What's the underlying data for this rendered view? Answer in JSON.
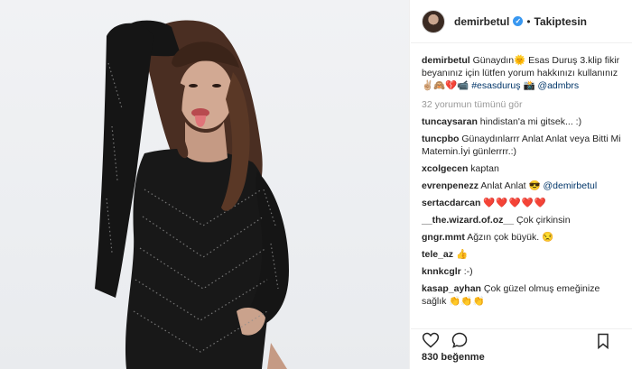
{
  "header": {
    "username": "demirbetul",
    "separator": "•",
    "follow_status": "Takiptesin"
  },
  "caption": {
    "username": "demirbetul",
    "text_1": "Günaydın🌞 Esas Duruş 3.klip fikir beyanınız için lütfen yorum hakkınızı kullanınız✌🏼🙈💔📹",
    "hashtag": "#esasduruş",
    "emoji": "📸",
    "mention": "@admbrs"
  },
  "view_all": "32 yorumun tümünü gör",
  "comments": [
    {
      "user": "tuncaysaran",
      "text": "hindistan'a mi gitsek... :)"
    },
    {
      "user": "tuncpbo",
      "text": "Günaydınlarrr Anlat Anlat veya Bitti Mi Matemin.İyi günlerrrr.:)"
    },
    {
      "user": "xcolgecen",
      "text": "kaptan"
    },
    {
      "user": "evrenpenezz",
      "text": "Anlat Anlat 😎",
      "mention": "@demirbetul"
    },
    {
      "user": "sertacdarcan",
      "text": "❤️❤️❤️❤️❤️"
    },
    {
      "user": "__the.wizard.of.oz__",
      "text": "Çok çirkinsin"
    },
    {
      "user": "gngr.mmt",
      "text": "Ağzın çok büyük. 😒"
    },
    {
      "user": "tele_az",
      "text": "👍"
    },
    {
      "user": "knnkcglr",
      "text": ":-)"
    },
    {
      "user": "kasap_ayhan",
      "text": "Çok güzel olmuş emeğinize sağlık 👏👏👏"
    }
  ],
  "likes": "830 beğenme",
  "icons": {
    "like": "heart-icon",
    "comment": "comment-icon",
    "save": "bookmark-icon",
    "verified": "verified-badge"
  },
  "colors": {
    "verified": "#3897f0",
    "link": "#003569",
    "muted": "#999999",
    "heart": "#d3202b"
  }
}
